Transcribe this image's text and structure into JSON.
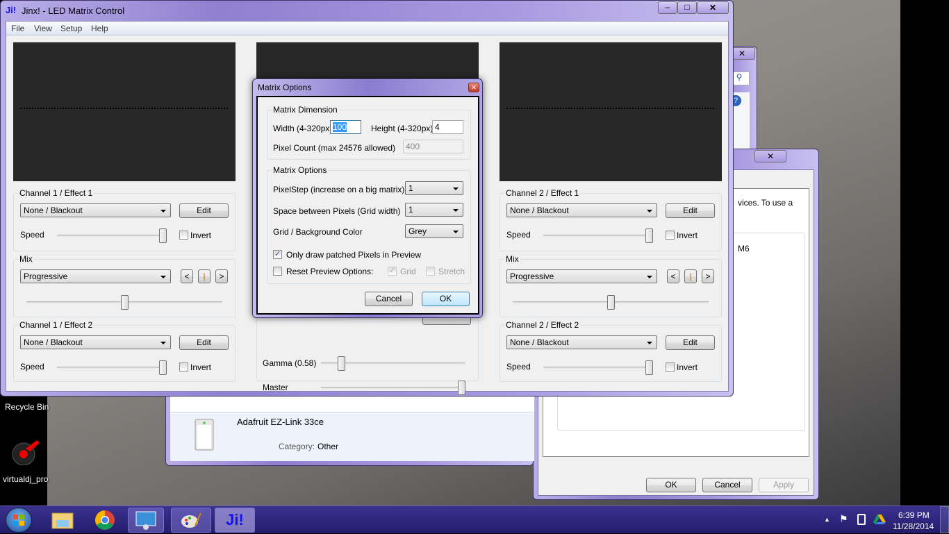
{
  "desktop": {
    "icons": [
      {
        "label": "Recycle Bin"
      },
      {
        "label": "virtualdj_pro"
      }
    ]
  },
  "main_window": {
    "logo": "Ji!",
    "title": "Jinx! - LED Matrix Control",
    "menu": [
      "File",
      "View",
      "Setup",
      "Help"
    ],
    "left": {
      "effect1": {
        "title": "Channel 1 / Effect 1",
        "combo": "None / Blackout",
        "edit": "Edit",
        "speed_label": "Speed",
        "speed": 1.0,
        "invert": "Invert",
        "invert_checked": false
      },
      "mix": {
        "title": "Mix",
        "combo": "Progressive",
        "prev": "<",
        "mid": "|",
        "next": ">",
        "value": 0.5
      },
      "effect2": {
        "title": "Channel 1 / Effect 2",
        "combo": "None / Blackout",
        "edit": "Edit",
        "speed_label": "Speed",
        "speed": 1.0,
        "invert": "Invert",
        "invert_checked": false
      }
    },
    "right": {
      "effect1": {
        "title": "Channel 2 / Effect 1",
        "combo": "None / Blackout",
        "edit": "Edit",
        "speed_label": "Speed",
        "speed": 1.0,
        "invert": "Invert",
        "invert_checked": false
      },
      "mix": {
        "title": "Mix",
        "combo": "Progressive",
        "prev": "<",
        "mid": "|",
        "next": ">",
        "value": 0.5
      },
      "effect2": {
        "title": "Channel 2 / Effect 2",
        "combo": "None / Blackout",
        "edit": "Edit",
        "speed_label": "Speed",
        "speed": 1.0,
        "invert": "Invert",
        "invert_checked": false
      }
    },
    "center": {
      "gamma_label": "Gamma (0.58)",
      "gamma": 0.12,
      "master_label": "Master",
      "master": 1.0
    }
  },
  "dialog": {
    "title": "Matrix Options",
    "dimension": {
      "title": "Matrix Dimension",
      "width_label": "Width (4-320px)",
      "width": "100",
      "height_label": "Height (4-320px)",
      "height": "4",
      "count_label": "Pixel Count (max 24576 allowed)",
      "count": "400"
    },
    "options": {
      "title": "Matrix Options",
      "pixelstep_label": "PixelStep (increase on a big matrix)",
      "pixelstep": "1",
      "space_label": "Space between Pixels (Grid width)",
      "space": "1",
      "color_label": "Grid / Background Color",
      "color": "Grey",
      "only_patched": "Only draw patched Pixels in Preview",
      "only_patched_checked": true,
      "reset": "Reset Preview Options:",
      "reset_checked": false,
      "grid": "Grid",
      "grid_checked": true,
      "stretch": "Stretch",
      "stretch_checked": false
    },
    "cancel": "Cancel",
    "ok": "OK"
  },
  "devices_window": {
    "device_name": "Adafruit EZ-Link 33ce",
    "category_label": "Category:",
    "category": "Other"
  },
  "properties_window": {
    "text1": "vices. To use a",
    "text2": "M6",
    "ok": "OK",
    "cancel": "Cancel",
    "apply": "Apply"
  },
  "taskbar": {
    "time": "6:39 PM",
    "date": "11/28/2014",
    "jinx_label": "Ji!"
  },
  "colors": {
    "accent": "#8f80d0",
    "preview_bg": "#282828",
    "ok_focus": "#3c7fb1"
  }
}
